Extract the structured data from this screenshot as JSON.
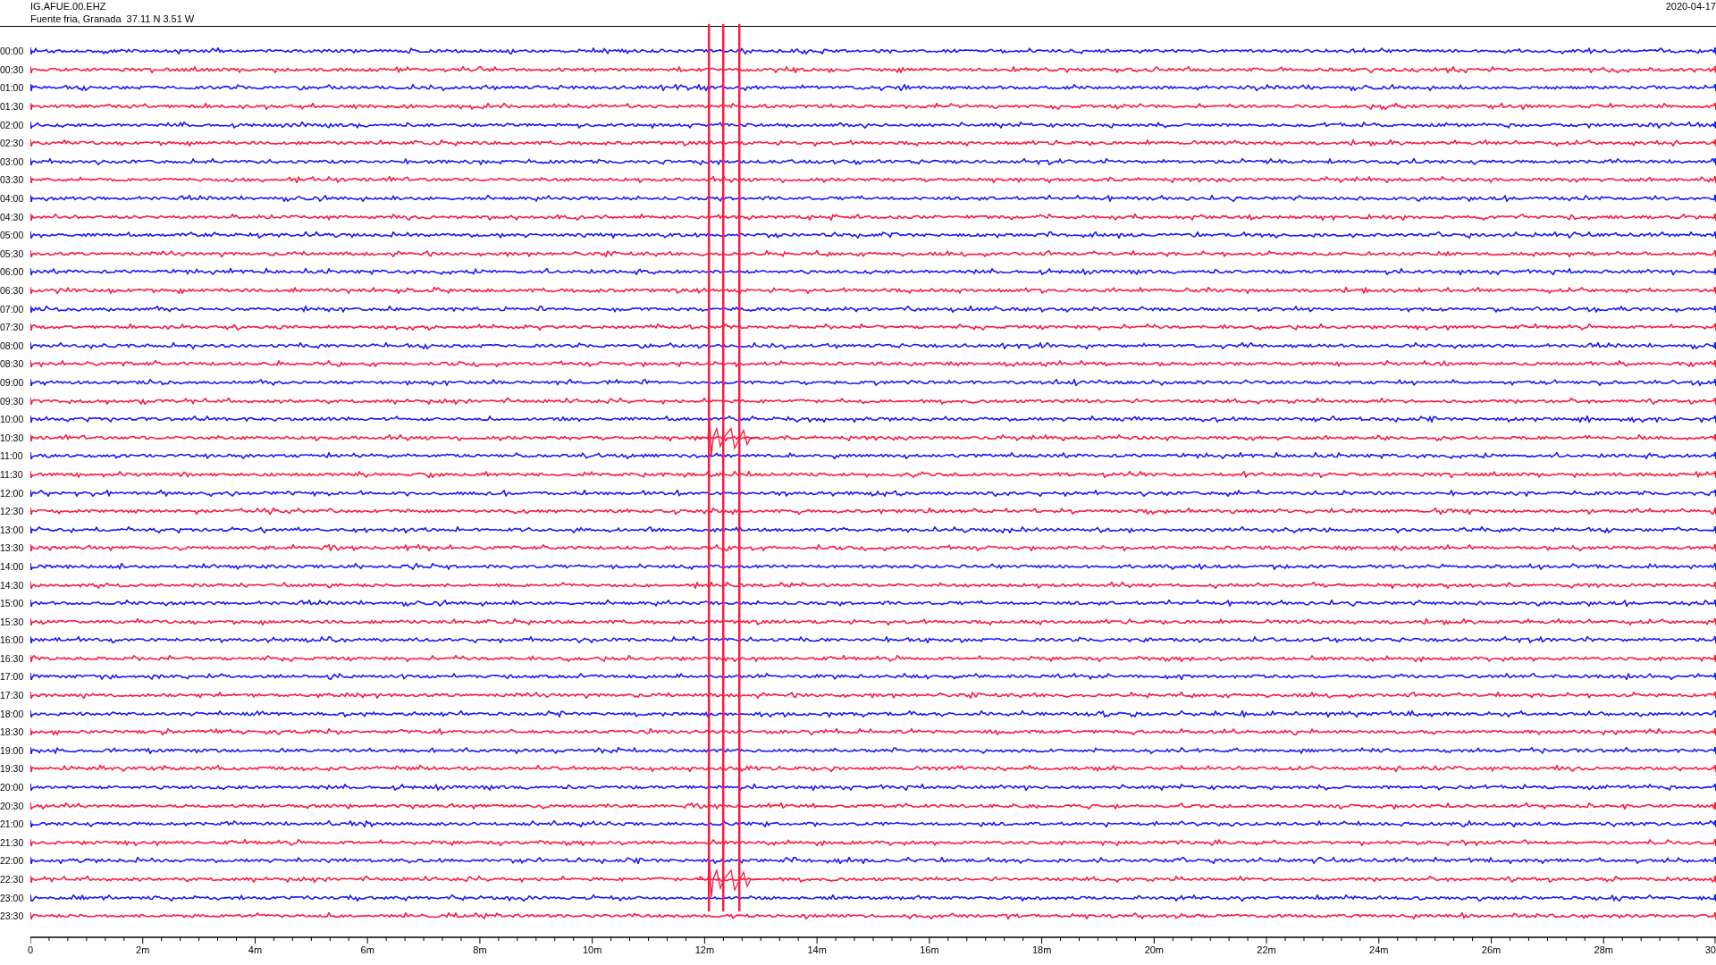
{
  "header": {
    "station": "IG.AFUE.00.EHZ",
    "location": "Fuente fria, Granada  37.11 N 3.51 W",
    "date": "2020-04-17"
  },
  "rows": [
    {
      "label": "00:00",
      "color": "#1a1aff"
    },
    {
      "label": "00:30",
      "color": "#ff1a40"
    },
    {
      "label": "01:00",
      "color": "#1a1aff"
    },
    {
      "label": "01:30",
      "color": "#ff1a40"
    },
    {
      "label": "02:00",
      "color": "#1a1aff"
    },
    {
      "label": "02:30",
      "color": "#ff1a40"
    },
    {
      "label": "03:00",
      "color": "#1a1aff"
    },
    {
      "label": "03:30",
      "color": "#ff1a40"
    },
    {
      "label": "04:00",
      "color": "#1a1aff"
    },
    {
      "label": "04:30",
      "color": "#ff1a40"
    },
    {
      "label": "05:00",
      "color": "#1a1aff"
    },
    {
      "label": "05:30",
      "color": "#ff1a40"
    },
    {
      "label": "06:00",
      "color": "#1a1aff"
    },
    {
      "label": "06:30",
      "color": "#ff1a40"
    },
    {
      "label": "07:00",
      "color": "#1a1aff"
    },
    {
      "label": "07:30",
      "color": "#ff1a40"
    },
    {
      "label": "08:00",
      "color": "#1a1aff"
    },
    {
      "label": "08:30",
      "color": "#ff1a40"
    },
    {
      "label": "09:00",
      "color": "#1a1aff"
    },
    {
      "label": "09:30",
      "color": "#ff1a40"
    },
    {
      "label": "10:00",
      "color": "#1a1aff"
    },
    {
      "label": "10:30",
      "color": "#ff1a40"
    },
    {
      "label": "11:00",
      "color": "#1a1aff"
    },
    {
      "label": "11:30",
      "color": "#ff1a40"
    },
    {
      "label": "12:00",
      "color": "#1a1aff"
    },
    {
      "label": "12:30",
      "color": "#ff1a40"
    },
    {
      "label": "13:00",
      "color": "#1a1aff"
    },
    {
      "label": "13:30",
      "color": "#ff1a40"
    },
    {
      "label": "14:00",
      "color": "#1a1aff"
    },
    {
      "label": "14:30",
      "color": "#ff1a40"
    },
    {
      "label": "15:00",
      "color": "#1a1aff"
    },
    {
      "label": "15:30",
      "color": "#ff1a40"
    },
    {
      "label": "16:00",
      "color": "#1a1aff"
    },
    {
      "label": "16:30",
      "color": "#ff1a40"
    },
    {
      "label": "17:00",
      "color": "#1a1aff"
    },
    {
      "label": "17:30",
      "color": "#ff1a40"
    },
    {
      "label": "18:00",
      "color": "#1a1aff"
    },
    {
      "label": "18:30",
      "color": "#ff1a40"
    },
    {
      "label": "19:00",
      "color": "#1a1aff"
    },
    {
      "label": "19:30",
      "color": "#ff1a40"
    },
    {
      "label": "20:00",
      "color": "#1a1aff"
    },
    {
      "label": "20:30",
      "color": "#ff1a40"
    },
    {
      "label": "21:00",
      "color": "#1a1aff"
    },
    {
      "label": "21:30",
      "color": "#ff1a40"
    },
    {
      "label": "22:00",
      "color": "#1a1aff"
    },
    {
      "label": "22:30",
      "color": "#ff1a40"
    },
    {
      "label": "23:00",
      "color": "#1a1aff"
    },
    {
      "label": "23:30",
      "color": "#ff1a40"
    }
  ],
  "x_axis": {
    "ticks": [
      "0",
      "2m",
      "4m",
      "6m",
      "8m",
      "10m",
      "12m",
      "14m",
      "16m",
      "18m",
      "20m",
      "22m",
      "24m",
      "26m",
      "28m",
      "30"
    ]
  }
}
